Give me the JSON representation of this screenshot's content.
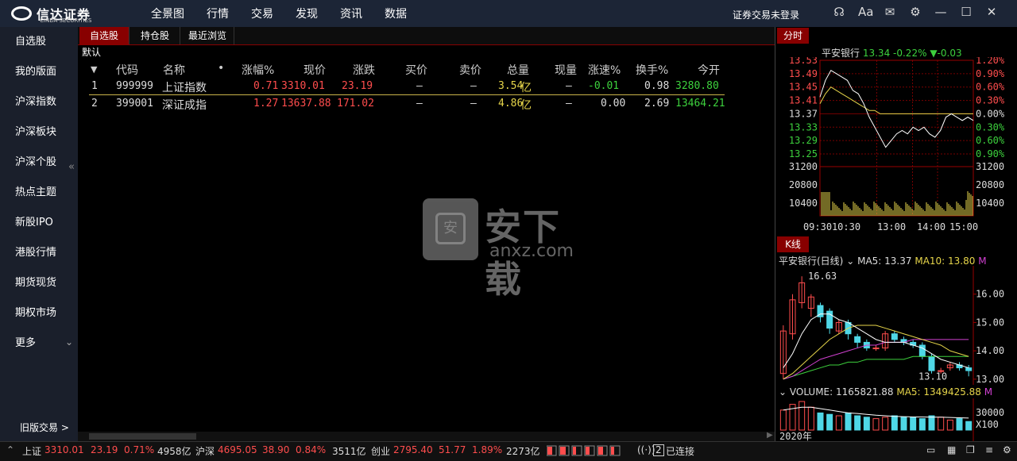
{
  "app": {
    "brand_cn": "信达证券",
    "brand_en": "CINDA SECURITIES",
    "login_status": "证券交易未登录"
  },
  "top_menu": [
    "全景图",
    "行情",
    "交易",
    "发现",
    "资讯",
    "数据"
  ],
  "window_icons": [
    "headset-icon",
    "font-size-icon",
    "mail-icon",
    "settings-icon",
    "minimize-icon",
    "maximize-icon",
    "close-icon"
  ],
  "window_glyphs": {
    "headset": "☊",
    "font": "Aa",
    "mail": "✉",
    "settings": "⚙",
    "minimize": "—",
    "maximize": "☐",
    "close": "✕"
  },
  "sidebar": {
    "items": [
      "自选股",
      "我的版面",
      "沪深指数",
      "沪深板块",
      "沪深个股",
      "热点主题",
      "新股IPO",
      "港股行情",
      "期货现货",
      "期权市场",
      "更多"
    ],
    "collapse": "«",
    "more_arrow": "⌄",
    "legacy": "旧版交易 >"
  },
  "tabs": [
    "自选股",
    "持仓股",
    "最近浏览"
  ],
  "group_label": "默认",
  "table": {
    "sort_marker": "▼",
    "dot": "•",
    "headers": [
      "代码",
      "名称",
      "涨幅%",
      "现价",
      "涨跌",
      "买价",
      "卖价",
      "总量",
      "现量",
      "涨速%",
      "换手%",
      "今开"
    ],
    "rows": [
      {
        "idx": "1",
        "code": "999999",
        "name": "上证指数",
        "chg_pct": "0.71",
        "price": "3310.01",
        "chg": "23.19",
        "bid": "—",
        "ask": "—",
        "vol": "3.54",
        "vol_unit": "亿",
        "cur": "—",
        "speed": "-0.01",
        "turnover": "0.98",
        "open": "3280.80"
      },
      {
        "idx": "2",
        "code": "399001",
        "name": "深证成指",
        "chg_pct": "1.27",
        "price": "13637.88",
        "chg": "171.02",
        "bid": "—",
        "ask": "—",
        "vol": "4.86",
        "vol_unit": "亿",
        "cur": "—",
        "speed": "0.00",
        "turnover": "2.69",
        "open": "13464.21"
      }
    ]
  },
  "watermark": {
    "cn": "安下载",
    "en": "anxz.com",
    "shield": "安"
  },
  "intraday": {
    "tab": "分时",
    "name": "平安银行",
    "price": "13.34",
    "pct": "-0.22%",
    "arrow": "▼",
    "change": "-0.03",
    "price_ticks": [
      "13.53",
      "13.49",
      "13.45",
      "13.41",
      "13.37",
      "13.33",
      "13.29",
      "13.25"
    ],
    "pct_ticks": [
      "1.20%",
      "0.90%",
      "0.60%",
      "0.30%",
      "0.00%",
      "0.30%",
      "0.60%",
      "0.90%"
    ],
    "vol_ticks": [
      "31200",
      "20800",
      "10400"
    ],
    "time_ticks": [
      "09:30",
      "10:30",
      "13:00",
      "14:00",
      "15:00"
    ],
    "price_path": [
      13.42,
      13.47,
      13.5,
      13.49,
      13.48,
      13.47,
      13.44,
      13.43,
      13.4,
      13.36,
      13.33,
      13.3,
      13.27,
      13.29,
      13.31,
      13.32,
      13.31,
      13.33,
      13.32,
      13.33,
      13.31,
      13.3,
      13.32,
      13.36,
      13.37,
      13.36,
      13.35,
      13.36,
      13.35
    ],
    "avg_path": [
      13.4,
      13.43,
      13.45,
      13.44,
      13.43,
      13.42,
      13.41,
      13.4,
      13.39,
      13.38,
      13.38,
      13.37,
      13.37,
      13.37,
      13.37,
      13.37,
      13.37,
      13.37,
      13.37,
      13.37,
      13.37,
      13.37,
      13.37,
      13.37,
      13.37,
      13.37,
      13.37,
      13.37,
      13.37
    ]
  },
  "kline": {
    "tab": "K线",
    "name": "平安银行(日线)",
    "ma5": "MA5: 13.37",
    "ma10": "MA10: 13.80",
    "ma_more": "M",
    "high_label": "16.63",
    "low_label": "13.10",
    "price_ticks": [
      "16.00",
      "15.00",
      "14.00",
      "13.00"
    ],
    "ylim": [
      12.8,
      17.0
    ],
    "candles": [
      {
        "o": 13.2,
        "c": 14.7,
        "h": 14.9,
        "l": 13.0
      },
      {
        "o": 14.6,
        "c": 15.8,
        "h": 16.0,
        "l": 14.4
      },
      {
        "o": 15.7,
        "c": 16.4,
        "h": 16.63,
        "l": 15.5
      },
      {
        "o": 15.5,
        "c": 15.9,
        "h": 16.0,
        "l": 15.2
      },
      {
        "o": 15.6,
        "c": 15.2,
        "h": 15.7,
        "l": 15.0
      },
      {
        "o": 15.4,
        "c": 14.8,
        "h": 15.5,
        "l": 14.6
      },
      {
        "o": 14.7,
        "c": 15.0,
        "h": 15.1,
        "l": 14.6
      },
      {
        "o": 15.0,
        "c": 14.6,
        "h": 15.1,
        "l": 14.4
      },
      {
        "o": 14.5,
        "c": 14.3,
        "h": 14.6,
        "l": 14.1
      },
      {
        "o": 14.3,
        "c": 14.1,
        "h": 14.4,
        "l": 14.0
      },
      {
        "o": 14.1,
        "c": 14.1,
        "h": 14.2,
        "l": 14.0
      },
      {
        "o": 14.1,
        "c": 14.6,
        "h": 14.7,
        "l": 14.0
      },
      {
        "o": 14.6,
        "c": 14.4,
        "h": 14.7,
        "l": 14.3
      },
      {
        "o": 14.4,
        "c": 14.3,
        "h": 14.5,
        "l": 14.2
      },
      {
        "o": 14.3,
        "c": 14.2,
        "h": 14.4,
        "l": 14.1
      },
      {
        "o": 14.2,
        "c": 13.8,
        "h": 14.3,
        "l": 13.7
      },
      {
        "o": 13.8,
        "c": 13.3,
        "h": 13.9,
        "l": 13.2
      },
      {
        "o": 13.3,
        "c": 13.3,
        "h": 13.4,
        "l": 13.2
      },
      {
        "o": 13.4,
        "c": 13.5,
        "h": 13.6,
        "l": 13.3
      },
      {
        "o": 13.5,
        "c": 13.4,
        "h": 13.6,
        "l": 13.3
      },
      {
        "o": 13.4,
        "c": 13.3,
        "h": 13.5,
        "l": 13.1
      }
    ],
    "ma_white": [
      13.4,
      13.9,
      14.6,
      15.1,
      15.3,
      15.3,
      15.1,
      15.0,
      14.8,
      14.6,
      14.4,
      14.3,
      14.3,
      14.3,
      14.2,
      14.1,
      13.9,
      13.7,
      13.6,
      13.5,
      13.4
    ],
    "ma_yellow": [
      13.0,
      13.2,
      13.5,
      13.8,
      14.1,
      14.4,
      14.6,
      14.8,
      14.9,
      14.9,
      14.9,
      14.8,
      14.7,
      14.6,
      14.5,
      14.4,
      14.3,
      14.2,
      14.0,
      13.9,
      13.8
    ],
    "ma_magenta": [
      13.0,
      13.1,
      13.3,
      13.5,
      13.7,
      13.8,
      13.9,
      14.0,
      14.1,
      14.2,
      14.2,
      14.3,
      14.3,
      14.3,
      14.4,
      14.4,
      14.4,
      14.4,
      14.4,
      14.4,
      14.4
    ],
    "ma_green": [
      13.0,
      13.1,
      13.2,
      13.3,
      13.4,
      13.5,
      13.5,
      13.6,
      13.6,
      13.7,
      13.7,
      13.7,
      13.7,
      13.7,
      13.8,
      13.8,
      13.8,
      13.8,
      13.8,
      13.8,
      13.8
    ]
  },
  "volume": {
    "label": "VOLUME: 1165821.88",
    "ma5": "MA5: 1349425.88",
    "ma_more": "M",
    "tick": "30000",
    "unit": "X100",
    "year": "2020年",
    "bars": [
      0.7,
      0.9,
      1.0,
      0.8,
      0.6,
      0.55,
      0.5,
      0.6,
      0.5,
      0.45,
      0.4,
      0.45,
      0.5,
      0.45,
      0.45,
      0.4,
      0.5,
      0.45,
      0.35,
      0.4,
      0.3
    ],
    "ma_line": [
      0.7,
      0.75,
      0.8,
      0.8,
      0.75,
      0.7,
      0.65,
      0.6,
      0.58,
      0.55,
      0.52,
      0.5,
      0.48,
      0.47,
      0.46,
      0.46,
      0.45,
      0.45,
      0.44,
      0.43,
      0.42
    ]
  },
  "status": {
    "sh_label": "上证",
    "sh_price": "3310.01",
    "sh_chg": "23.19",
    "sh_pct": "0.71%",
    "sh_amt": "4958亿",
    "hs_label": "沪深",
    "hs_price": "4695.05",
    "hs_chg": "38.90",
    "hs_pct": "0.84%",
    "hs_amt": "3511亿",
    "cy_label": "创业",
    "cy_price": "2795.40",
    "cy_chg": "51.77",
    "cy_pct": "1.89%",
    "cy_amt": "2273亿",
    "conn_count": "2",
    "conn_text": "已连接"
  },
  "colors": {
    "up": "#ff4d4d",
    "down": "#3dd13d",
    "accent": "#800000",
    "volume": "#e6d54a"
  }
}
